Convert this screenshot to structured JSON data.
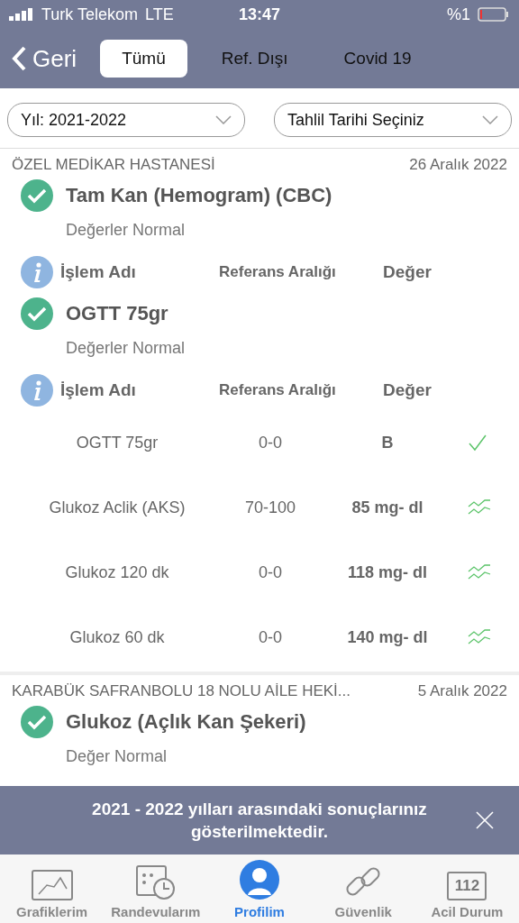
{
  "status_bar": {
    "carrier": "Turk Telekom",
    "network": "LTE",
    "time": "13:47",
    "battery": "%1"
  },
  "nav": {
    "back": "Geri",
    "tabs": [
      {
        "label": "Tümü",
        "selected": true
      },
      {
        "label": "Ref. Dışı",
        "selected": false
      },
      {
        "label": "Covid 19",
        "selected": false
      }
    ]
  },
  "filters": [
    {
      "value": "Yıl: 2021-2022"
    },
    {
      "value": "Tahlil Tarihi Seçiniz"
    }
  ],
  "groups": [
    {
      "institution": "ÖZEL MEDİKAR HASTANESİ",
      "date": "26 Aralık 2022",
      "tests": [
        {
          "name": "Tam Kan (Hemogram) (CBC)",
          "status": "Değerler Normal",
          "columns": [
            "İşlem Adı",
            "Referans Aralığı",
            "Değer"
          ]
        },
        {
          "name": "OGTT 75gr",
          "status": "Değerler Normal",
          "columns": [
            "İşlem Adı",
            "Referans Aralığı",
            "Değer"
          ],
          "rows": [
            {
              "name": "OGTT 75gr",
              "range": "0-0",
              "value": "B",
              "kind": "check"
            },
            {
              "name": "Glukoz Aclik (AKS)",
              "range": "70-100",
              "value": "85 mg- dl",
              "kind": "trend"
            },
            {
              "name": "Glukoz 120 dk",
              "range": "0-0",
              "value": "118 mg- dl",
              "kind": "trend"
            },
            {
              "name": "Glukoz 60 dk",
              "range": "0-0",
              "value": "140 mg- dl",
              "kind": "trend"
            }
          ]
        }
      ]
    },
    {
      "institution": "KARABÜK SAFRANBOLU 18 NOLU AİLE HEKİ...",
      "date": "5 Aralık 2022",
      "tests": [
        {
          "name": "Glukoz (Açlık Kan Şekeri)",
          "status": "Değer Normal"
        }
      ]
    }
  ],
  "banner": {
    "text": "2021 - 2022 yılları arasındaki sonuçlarınız gösterilmektedir."
  },
  "tab_bar": [
    {
      "label": "Grafiklerim",
      "kind": "chart",
      "selected": false
    },
    {
      "label": "Randevularım",
      "kind": "calendar",
      "selected": false
    },
    {
      "label": "Profilim",
      "kind": "person",
      "selected": true
    },
    {
      "label": "Güvenlik",
      "kind": "link",
      "selected": false
    },
    {
      "label": "Acil Durum",
      "kind": "emergency",
      "selected": false,
      "badge": "112"
    }
  ]
}
